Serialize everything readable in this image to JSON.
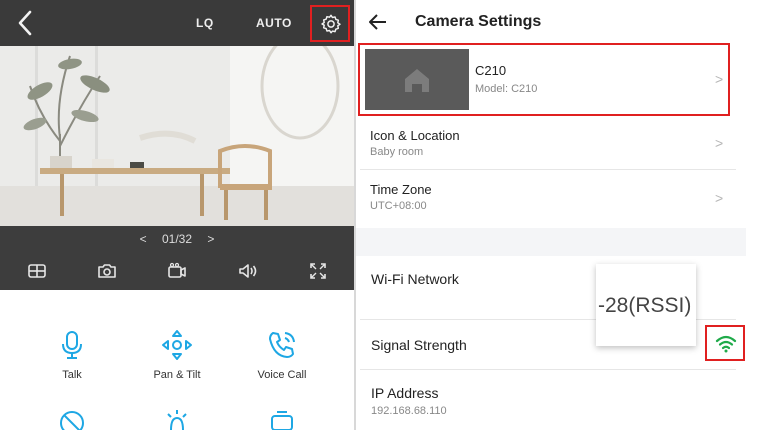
{
  "live_view": {
    "quality": "LQ",
    "mode": "AUTO",
    "pager": {
      "prev": "<",
      "position": "01/32",
      "next": ">"
    },
    "actions": [
      {
        "label": "Talk"
      },
      {
        "label": "Pan & Tilt"
      },
      {
        "label": "Voice Call"
      }
    ]
  },
  "settings": {
    "title": "Camera Settings",
    "camera": {
      "name": "C210",
      "model": "Model: C210"
    },
    "rows": [
      {
        "title": "Icon & Location",
        "subtitle": "Baby room"
      },
      {
        "title": "Time Zone",
        "subtitle": "UTC+08:00"
      }
    ],
    "wifi": {
      "title": "Wi-Fi Network"
    },
    "signal": {
      "title": "Signal Strength",
      "rssi": "-28(RSSI)"
    },
    "ip": {
      "title": "IP Address",
      "value": "192.168.68.110"
    },
    "chevron": ">"
  },
  "colors": {
    "accent": "#1ea7e4",
    "highlight": "#e02020",
    "signal": "#1faa4a",
    "dark_bar": "#3a3a3a"
  },
  "icons": [
    "back-arrow-icon",
    "gear-icon",
    "split-view-icon",
    "camera-icon",
    "record-icon",
    "speaker-icon",
    "fullscreen-icon",
    "microphone-icon",
    "pan-tilt-icon",
    "phone-call-icon",
    "wifi-icon",
    "home-icon"
  ]
}
